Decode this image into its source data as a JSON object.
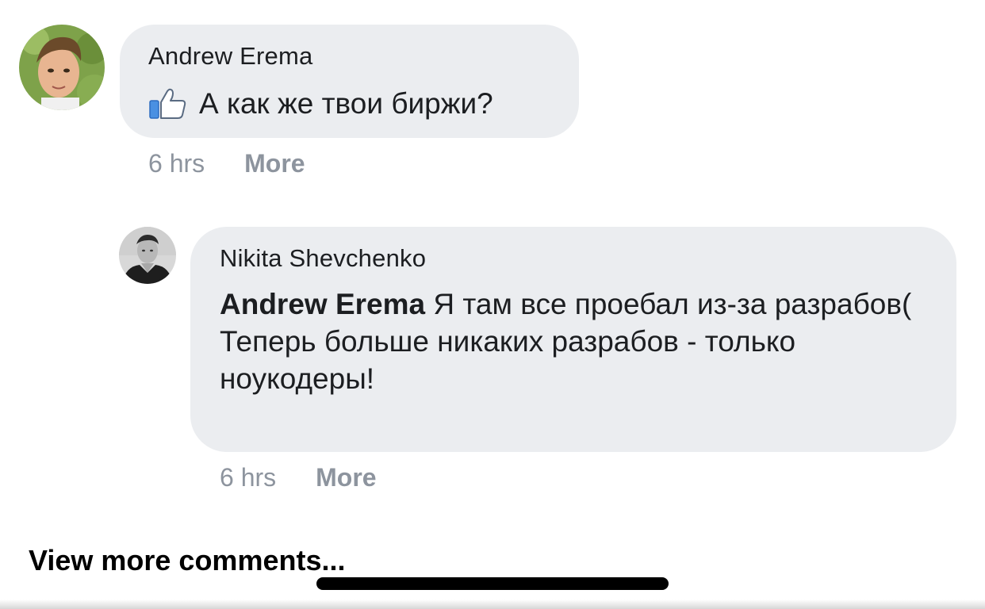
{
  "comments": [
    {
      "author": "Andrew Erema",
      "text": "А как же твои биржи?",
      "time": "6 hrs",
      "more_label": "More",
      "prefix_icon": "thumbs-up-icon"
    },
    {
      "author": "Nikita Shevchenko",
      "mention": "Andrew Erema",
      "text_line_1": " Я там все проебал из-за разрабов(",
      "text_line_2": "Теперь больше никаких разрабов - только ноукодеры!",
      "time": "6 hrs",
      "more_label": "More"
    }
  ],
  "view_more_label": "View more comments...",
  "colors": {
    "bubble": "#ebedf0",
    "meta_text": "#8d949e",
    "primary_text": "#1c1e21",
    "like_blue": "#4a90e2"
  }
}
